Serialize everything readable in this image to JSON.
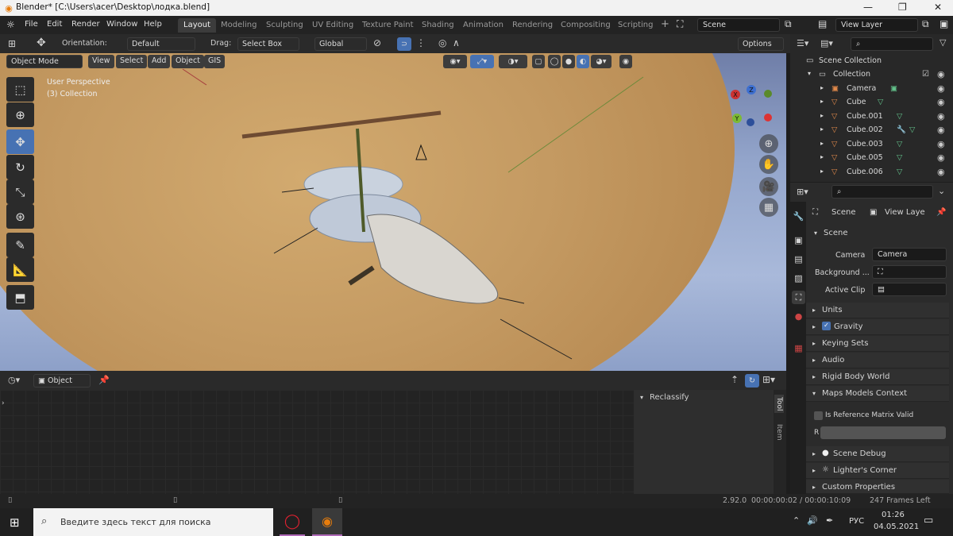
{
  "window": {
    "title": "Blender* [C:\\Users\\acer\\Desktop\\лодка.blend]"
  },
  "menu": [
    "File",
    "Edit",
    "Render",
    "Window",
    "Help"
  ],
  "workspaces": [
    "Layout",
    "Modeling",
    "Sculpting",
    "UV Editing",
    "Texture Paint",
    "Shading",
    "Animation",
    "Rendering",
    "Compositing",
    "Scripting"
  ],
  "active_workspace": "Layout",
  "scene_field": "Scene",
  "view_layer_field": "View Layer",
  "toolheader": {
    "orientation_label": "Orientation:",
    "orientation_value": "Default",
    "drag_label": "Drag:",
    "drag_value": "Select Box",
    "transform_orientation": "Global",
    "options": "Options"
  },
  "viewport_header": {
    "mode": "Object Mode",
    "menus": [
      "View",
      "Select",
      "Add",
      "Object",
      "GIS"
    ]
  },
  "viewport": {
    "perspective": "User Perspective",
    "collection": "(3) Collection",
    "gizmo": {
      "x": "X",
      "y": "Y",
      "z": "Z"
    }
  },
  "outliner": {
    "root": "Scene Collection",
    "collection": "Collection",
    "items": [
      "Camera",
      "Cube",
      "Cube.001",
      "Cube.002",
      "Cube.003",
      "Cube.005",
      "Cube.006"
    ]
  },
  "properties": {
    "tab_scene": "Scene",
    "tab_view_layer": "View Laye",
    "section": "Scene",
    "camera_label": "Camera",
    "camera_value": "Camera",
    "background_label": "Background ...",
    "active_clip_label": "Active Clip",
    "panels": [
      "Units",
      "Gravity",
      "Keying Sets",
      "Audio",
      "Rigid Body World",
      "Maps Models Context"
    ],
    "is_ref_matrix": "Is Reference Matrix Valid",
    "r_label": "R",
    "panels2": [
      "Scene Debug",
      "Lighter's Corner",
      "Custom Properties"
    ],
    "gravity_checked": true
  },
  "editor": {
    "type": "Object",
    "reclassify": "Reclassify",
    "side_tabs": [
      "Tool",
      "Item"
    ]
  },
  "status": {
    "version": "2.92.0",
    "time": "00:00:00:02 / 00:00:10:09",
    "frames_left": "247 Frames Left"
  },
  "taskbar": {
    "search_placeholder": "Введите здесь текст для поиска",
    "lang": "РУС",
    "time": "01:26",
    "date": "04.05.2021"
  },
  "colors": {
    "accent": "#4772b3",
    "active_tab": "#3c3c3c",
    "sand": "#c49a62"
  }
}
